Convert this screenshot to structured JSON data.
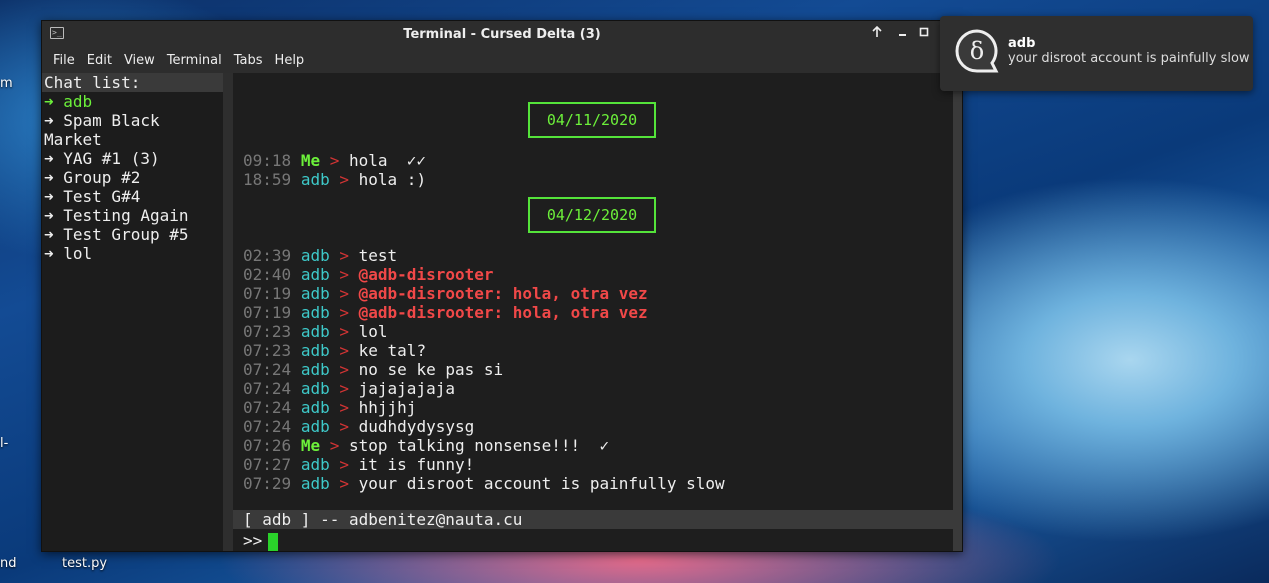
{
  "window": {
    "title": "Terminal - Cursed Delta (3)",
    "menu": [
      "File",
      "Edit",
      "View",
      "Terminal",
      "Tabs",
      "Help"
    ]
  },
  "sidebar": {
    "header": "Chat list:",
    "items": [
      {
        "label": "➜ adb",
        "active": true
      },
      {
        "label": "➜ Spam Black Market",
        "active": false
      },
      {
        "label": "➜ YAG #1 (3)",
        "active": false
      },
      {
        "label": "➜ Group #2",
        "active": false
      },
      {
        "label": "➜ Test G#4",
        "active": false
      },
      {
        "label": "➜ Testing Again",
        "active": false
      },
      {
        "label": "➜ Test Group #5",
        "active": false
      },
      {
        "label": "➜ lol",
        "active": false
      }
    ]
  },
  "dates": [
    "04/11/2020",
    "04/12/2020"
  ],
  "messages": [
    {
      "time": "09:18",
      "sender": "Me",
      "arrow": ">",
      "text": "hola",
      "status": "✓✓",
      "mention": false
    },
    {
      "time": "18:59",
      "sender": "adb",
      "arrow": ">",
      "text": "hola :)",
      "status": "",
      "mention": false
    },
    {
      "time": "02:39",
      "sender": "adb",
      "arrow": ">",
      "text": "test",
      "status": "",
      "mention": false
    },
    {
      "time": "02:40",
      "sender": "adb",
      "arrow": ">",
      "text": "@adb-disrooter",
      "status": "",
      "mention": true
    },
    {
      "time": "07:19",
      "sender": "adb",
      "arrow": ">",
      "text": "@adb-disrooter: hola, otra vez",
      "status": "",
      "mention": true
    },
    {
      "time": "07:19",
      "sender": "adb",
      "arrow": ">",
      "text": "@adb-disrooter: hola, otra vez",
      "status": "",
      "mention": true
    },
    {
      "time": "07:23",
      "sender": "adb",
      "arrow": ">",
      "text": "lol",
      "status": "",
      "mention": false
    },
    {
      "time": "07:23",
      "sender": "adb",
      "arrow": ">",
      "text": "ke tal?",
      "status": "",
      "mention": false
    },
    {
      "time": "07:24",
      "sender": "adb",
      "arrow": ">",
      "text": "no se ke pas si",
      "status": "",
      "mention": false
    },
    {
      "time": "07:24",
      "sender": "adb",
      "arrow": ">",
      "text": "jajajajaja",
      "status": "",
      "mention": false
    },
    {
      "time": "07:24",
      "sender": "adb",
      "arrow": ">",
      "text": "hhjjhj",
      "status": "",
      "mention": false
    },
    {
      "time": "07:24",
      "sender": "adb",
      "arrow": ">",
      "text": "dudhdydysysg",
      "status": "",
      "mention": false
    },
    {
      "time": "07:26",
      "sender": "Me",
      "arrow": ">",
      "text": "stop talking nonsense!!!",
      "status": "✓",
      "mention": false
    },
    {
      "time": "07:27",
      "sender": "adb",
      "arrow": ">",
      "text": "it is funny!",
      "status": "",
      "mention": false
    },
    {
      "time": "07:29",
      "sender": "adb",
      "arrow": ">",
      "text": "your disroot account is painfully slow",
      "status": "",
      "mention": false
    }
  ],
  "statusbar": "[ adb ] -- adbenitez@nauta.cu",
  "prompt": ">>",
  "notification": {
    "title": "adb",
    "body": "your disroot account is painfully slow",
    "icon": "delta-chat-icon"
  },
  "desktop": {
    "labels": [
      "m",
      "l-",
      "nd",
      "test.py"
    ]
  },
  "colors": {
    "accent_green": "#6cf03a",
    "sender_adb": "#3ec9c9",
    "mention_red": "#f04848"
  }
}
